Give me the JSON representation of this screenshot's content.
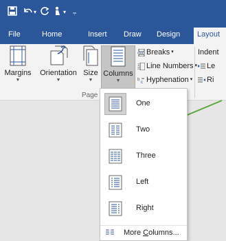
{
  "quick_access": {
    "save": "save-icon",
    "undo": "undo-icon",
    "redo": "redo-icon",
    "touch": "touch-mode-icon",
    "customize": "customize-icon"
  },
  "tabs": [
    {
      "label": "File"
    },
    {
      "label": "Home"
    },
    {
      "label": "Insert"
    },
    {
      "label": "Draw"
    },
    {
      "label": "Design"
    },
    {
      "label": "Layout"
    }
  ],
  "ribbon": {
    "margins": "Margins",
    "orientation": "Orientation",
    "size": "Size",
    "columns": "Columns",
    "breaks": "Breaks",
    "line_numbers": "Line Numbers",
    "hyphenation": "Hyphenation",
    "group_label": "Page S",
    "indent": "Indent",
    "indent_left": "Le",
    "indent_right": "Ri"
  },
  "columns_menu": {
    "items": [
      {
        "label": "One",
        "selected": true
      },
      {
        "label": "Two",
        "selected": false
      },
      {
        "label": "Three",
        "selected": false
      },
      {
        "label": "Left",
        "selected": false
      },
      {
        "label": "Right",
        "selected": false
      }
    ],
    "more_pre": "More ",
    "more_key": "C",
    "more_post": "olumns..."
  },
  "colors": {
    "ribbon_blue": "#2b579a",
    "callout": "#5aa83a"
  }
}
